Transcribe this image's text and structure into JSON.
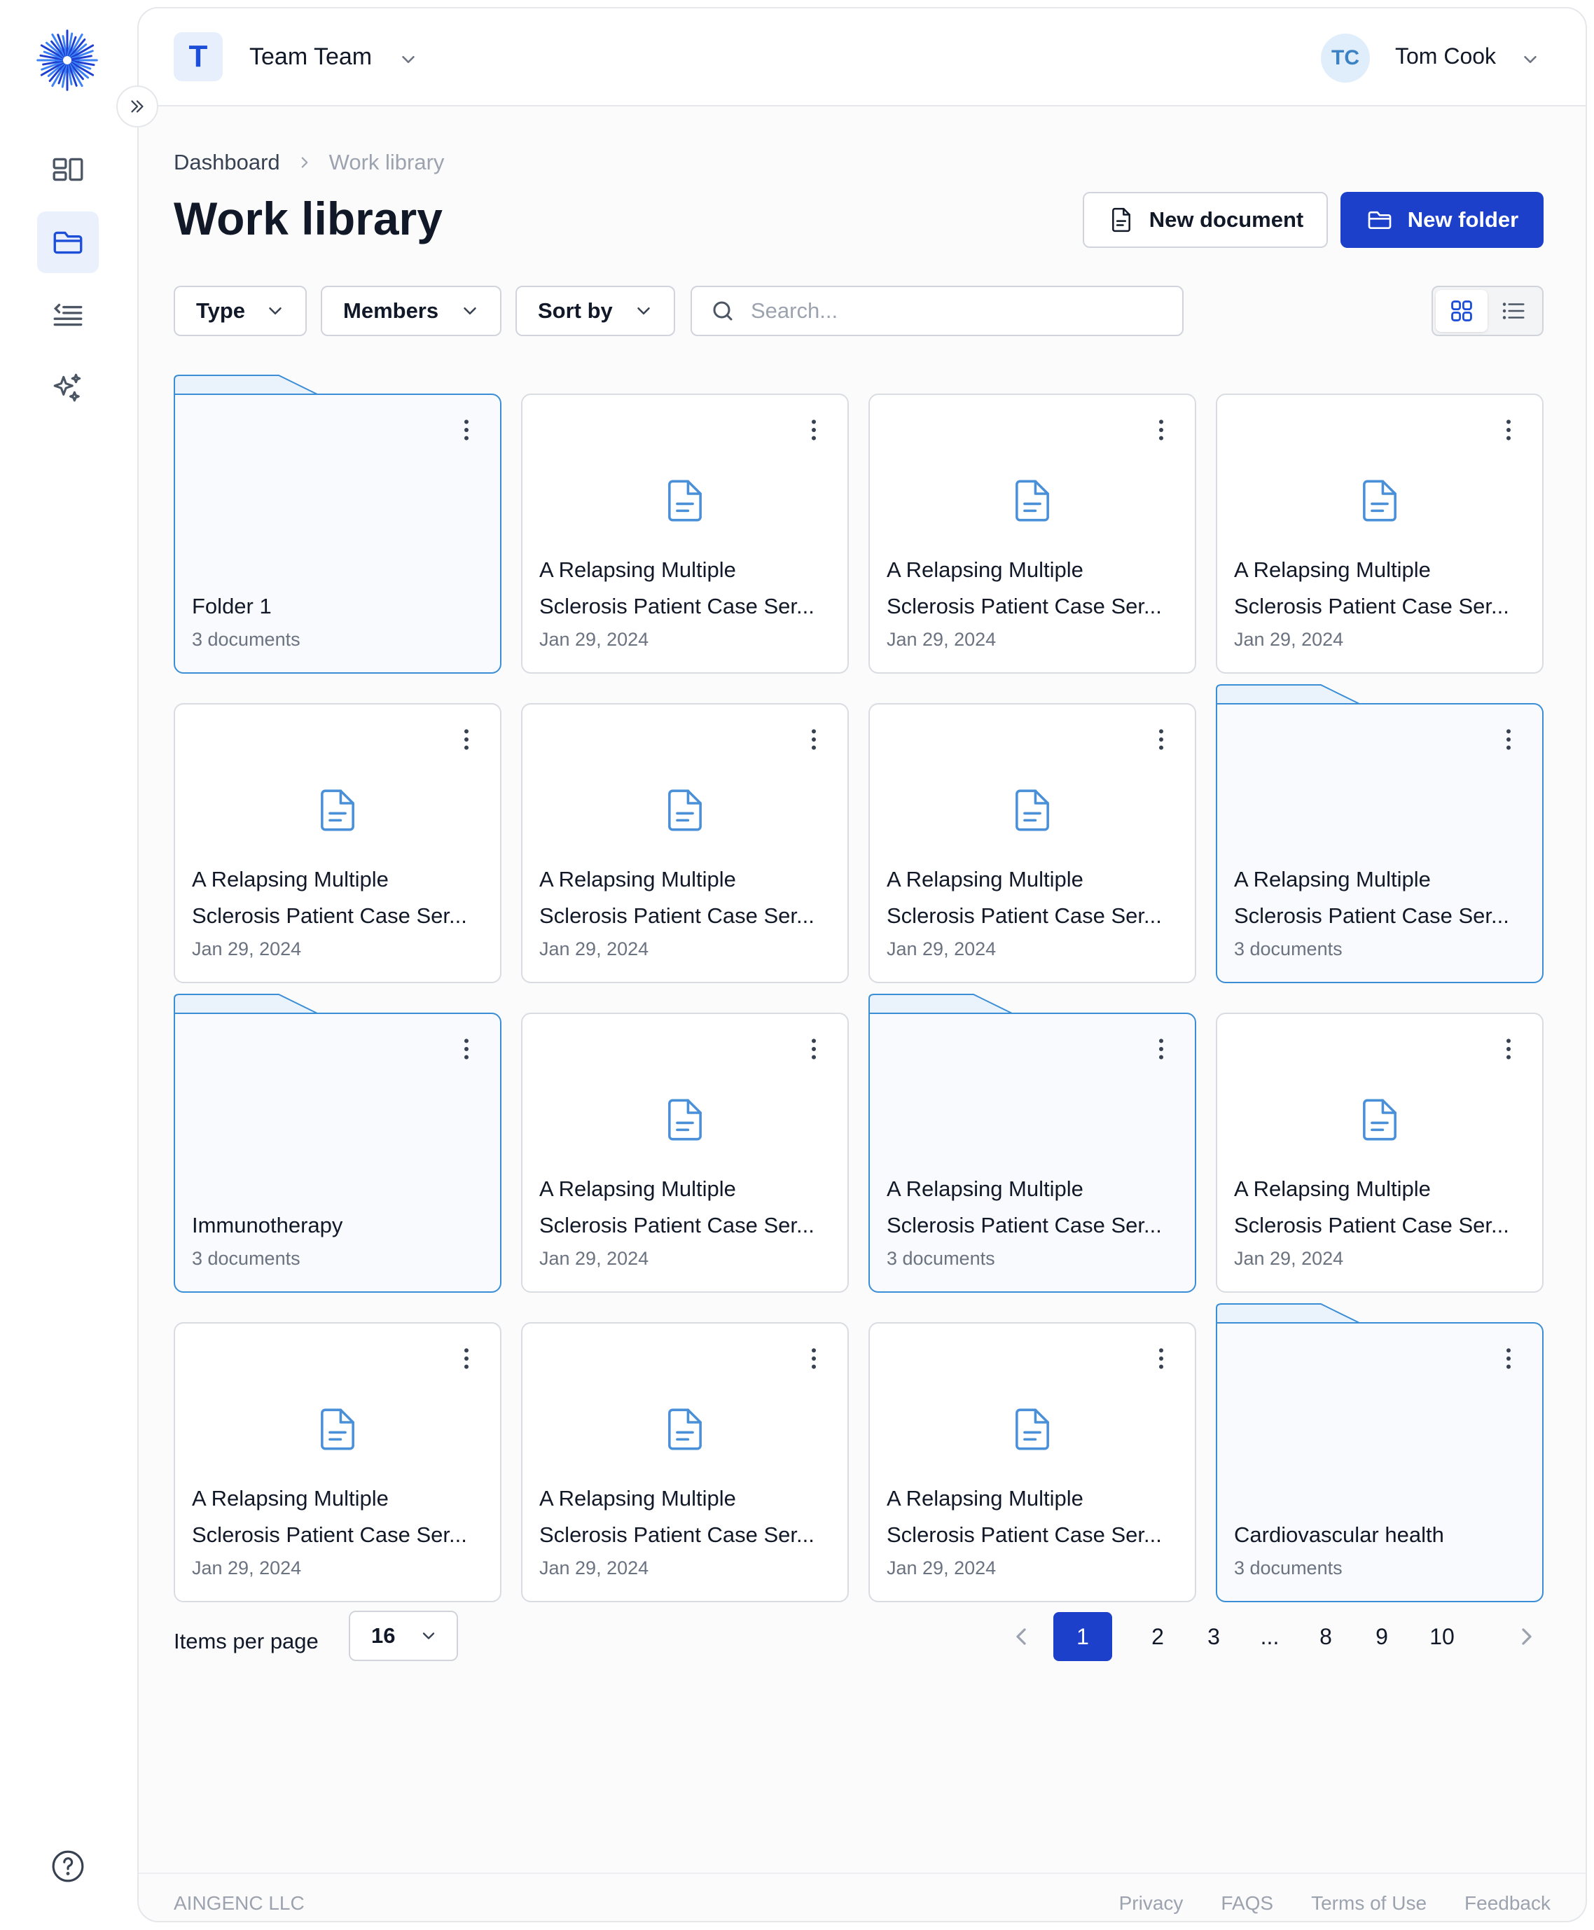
{
  "team": {
    "badge": "T",
    "name": "Team Team"
  },
  "user": {
    "initials": "TC",
    "name": "Tom Cook"
  },
  "breadcrumb": {
    "root": "Dashboard",
    "current": "Work library"
  },
  "page": {
    "title": "Work library"
  },
  "actions": {
    "new_document": "New document",
    "new_folder": "New folder"
  },
  "filters": {
    "type": "Type",
    "members": "Members",
    "sort": "Sort by"
  },
  "search": {
    "placeholder": "Search...",
    "value": ""
  },
  "view": {
    "selected": "grid"
  },
  "items": [
    {
      "kind": "folder",
      "line1": "",
      "line2": "Folder 1",
      "meta": "3 documents"
    },
    {
      "kind": "doc",
      "line1": "A Relapsing Multiple",
      "line2": "Sclerosis Patient Case Ser...",
      "meta": "Jan 29, 2024"
    },
    {
      "kind": "doc",
      "line1": "A Relapsing Multiple",
      "line2": "Sclerosis Patient Case Ser...",
      "meta": "Jan 29, 2024"
    },
    {
      "kind": "doc",
      "line1": "A Relapsing Multiple",
      "line2": "Sclerosis Patient Case Ser...",
      "meta": "Jan 29, 2024"
    },
    {
      "kind": "doc",
      "line1": "A Relapsing Multiple",
      "line2": "Sclerosis Patient Case Ser...",
      "meta": "Jan 29, 2024"
    },
    {
      "kind": "doc",
      "line1": "A Relapsing Multiple",
      "line2": "Sclerosis Patient Case Ser...",
      "meta": "Jan 29, 2024"
    },
    {
      "kind": "doc",
      "line1": "A Relapsing Multiple",
      "line2": "Sclerosis Patient Case Ser...",
      "meta": "Jan 29, 2024"
    },
    {
      "kind": "folder",
      "line1": "A Relapsing Multiple",
      "line2": "Sclerosis Patient Case Ser...",
      "meta": "3 documents"
    },
    {
      "kind": "folder",
      "line1": "",
      "line2": "Immunotherapy",
      "meta": "3 documents"
    },
    {
      "kind": "doc",
      "line1": "A Relapsing Multiple",
      "line2": "Sclerosis Patient Case Ser...",
      "meta": "Jan 29, 2024"
    },
    {
      "kind": "folder",
      "line1": "A Relapsing Multiple",
      "line2": "Sclerosis Patient Case Ser...",
      "meta": "3 documents"
    },
    {
      "kind": "doc",
      "line1": "A Relapsing Multiple",
      "line2": "Sclerosis Patient Case Ser...",
      "meta": "Jan 29, 2024"
    },
    {
      "kind": "doc",
      "line1": "A Relapsing Multiple",
      "line2": "Sclerosis Patient Case Ser...",
      "meta": "Jan 29, 2024"
    },
    {
      "kind": "doc",
      "line1": "A Relapsing Multiple",
      "line2": "Sclerosis Patient Case Ser...",
      "meta": "Jan 29, 2024"
    },
    {
      "kind": "doc",
      "line1": "A Relapsing Multiple",
      "line2": "Sclerosis Patient Case Ser...",
      "meta": "Jan 29, 2024"
    },
    {
      "kind": "folder",
      "line1": "",
      "line2": "Cardiovascular health",
      "meta": "3 documents"
    }
  ],
  "pagination": {
    "items_per_page_label": "Items per page",
    "items_per_page": "16",
    "pages": [
      "1",
      "2",
      "3",
      "...",
      "8",
      "9",
      "10"
    ],
    "current": "1"
  },
  "footer": {
    "company": "AINGENC LLC",
    "links": [
      "Privacy",
      "FAQS",
      "Terms of Use",
      "Feedback"
    ]
  },
  "colors": {
    "primary": "#1c40c9",
    "folder_border": "#3b8ed6",
    "doc_icon": "#4a90d9"
  },
  "icons": {
    "rail": [
      "dashboard-icon",
      "folder-icon",
      "list-icon",
      "sparkles-icon"
    ],
    "card_menu": "more-vertical-icon",
    "document": "document-icon"
  }
}
